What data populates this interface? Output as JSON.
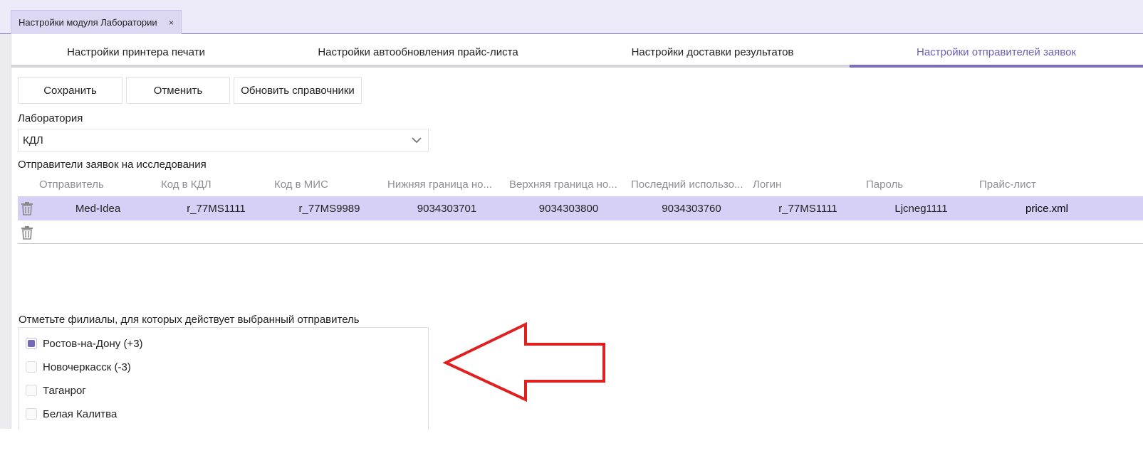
{
  "window": {
    "tab_title": "Настройки модуля Лаборатории",
    "close_glyph": "×"
  },
  "tabs": [
    {
      "label": "Настройки принтера печати",
      "active": false
    },
    {
      "label": "Настройки автообновления прайс-листа",
      "active": false
    },
    {
      "label": "Настройки доставки результатов",
      "active": false
    },
    {
      "label": "Настройки отправителей заявок",
      "active": true
    }
  ],
  "toolbar": {
    "save_label": "Сохранить",
    "cancel_label": "Отменить",
    "refresh_label": "Обновить справочники"
  },
  "lab": {
    "label": "Лаборатория",
    "selected": "КДЛ"
  },
  "senders": {
    "section_label": "Отправители заявок на исследования",
    "columns": [
      "Отправитель",
      "Код в КДЛ",
      "Код в МИС",
      "Нижняя граница но...",
      "Верхняя граница но...",
      "Последний использо...",
      "Логин",
      "Пароль",
      "Прайс-лист"
    ],
    "rows": [
      [
        "Med-Idea",
        "r_77MS1111",
        "r_77MS9989",
        "9034303701",
        "9034303800",
        "9034303760",
        "r_77MS1111",
        "Ljcneg1111",
        "price.xml"
      ]
    ]
  },
  "branches": {
    "label": "Отметьте филиалы, для которых действует выбранный отправитель",
    "items": [
      {
        "label": "Ростов-на-Дону (+3)",
        "checked": true
      },
      {
        "label": "Новочеркасск (-3)",
        "checked": false
      },
      {
        "label": "Таганрог",
        "checked": false
      },
      {
        "label": "Белая Калитва",
        "checked": false
      }
    ]
  },
  "colors": {
    "accent": "#7a6cbf",
    "selected_row": "#d6cff6",
    "annotation_arrow": "#e02020"
  },
  "icons": {
    "trash": "trash-icon",
    "chevron": "chevron-down-icon",
    "annotation": "arrow-left-icon"
  }
}
